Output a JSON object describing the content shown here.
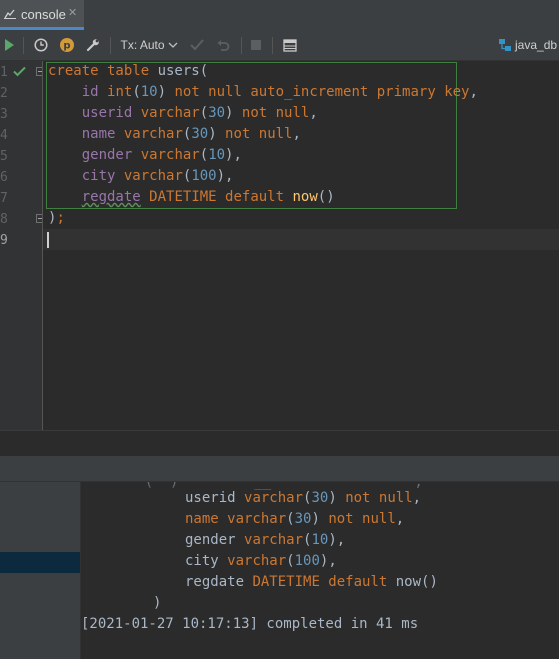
{
  "tab": {
    "label": "console",
    "close_glyph": "✕",
    "icon": "console-icon"
  },
  "toolbar": {
    "run_icon": "run-icon",
    "history_icon": "history-icon",
    "profile_glyph": "p",
    "settings_icon": "wrench-icon",
    "tx_mode": "Tx: Auto",
    "datasource_label": "java_db"
  },
  "editor": {
    "line_numbers": [
      "1",
      "2",
      "3",
      "4",
      "5",
      "6",
      "7",
      "8",
      "9"
    ],
    "statement_status": "success-checkmark"
  },
  "output": {
    "lines": [
      "userid varchar(30) not null,",
      "name varchar(30) not null,",
      "gender varchar(10),",
      "city varchar(100),",
      "regdate DATETIME default now()",
      ")"
    ],
    "status": "[2021-01-27 10:17:13] completed in 41 ms"
  },
  "colors": {
    "keyword": "#cc7832",
    "number": "#6897bb",
    "identifier": "#9876aa",
    "function": "#ffc66d",
    "text": "#a9b7c6"
  }
}
